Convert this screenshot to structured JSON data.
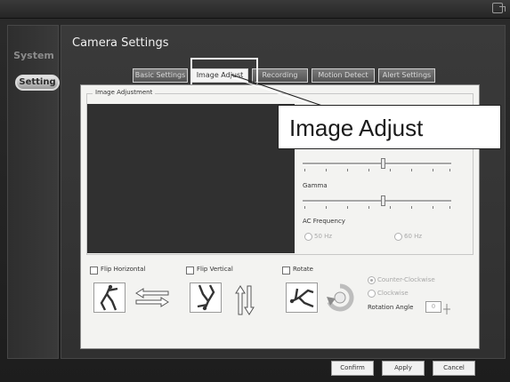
{
  "sidebar": {
    "system_label": "System",
    "setting_label": "Setting"
  },
  "main": {
    "title": "Camera Settings"
  },
  "tabs": [
    {
      "label": "Basic Settings"
    },
    {
      "label": "Image Adjust"
    },
    {
      "label": "Recording"
    },
    {
      "label": "Motion Detect"
    },
    {
      "label": "Alert Settings"
    }
  ],
  "active_tab": "Image Adjust",
  "image_adjust": {
    "group_label": "Image Adjustment",
    "gamma_label": "Gamma",
    "ac_frequency_label": "AC Frequency",
    "ac_frequency_options": [
      {
        "label": "50 Hz"
      },
      {
        "label": "60 Hz"
      }
    ],
    "flip_horizontal_label": "Flip Horizontal",
    "flip_vertical_label": "Flip Vertical",
    "rotate_label": "Rotate",
    "rotate_options": [
      {
        "label": "Counter-Clockwise"
      },
      {
        "label": "Clockwise"
      }
    ],
    "rotation_angle_label": "Rotation Angle",
    "rotation_angle_value": "0"
  },
  "callout": {
    "text": "Image Adjust"
  },
  "buttons": {
    "confirm": "Confirm",
    "apply": "Apply",
    "cancel": "Cancel"
  }
}
